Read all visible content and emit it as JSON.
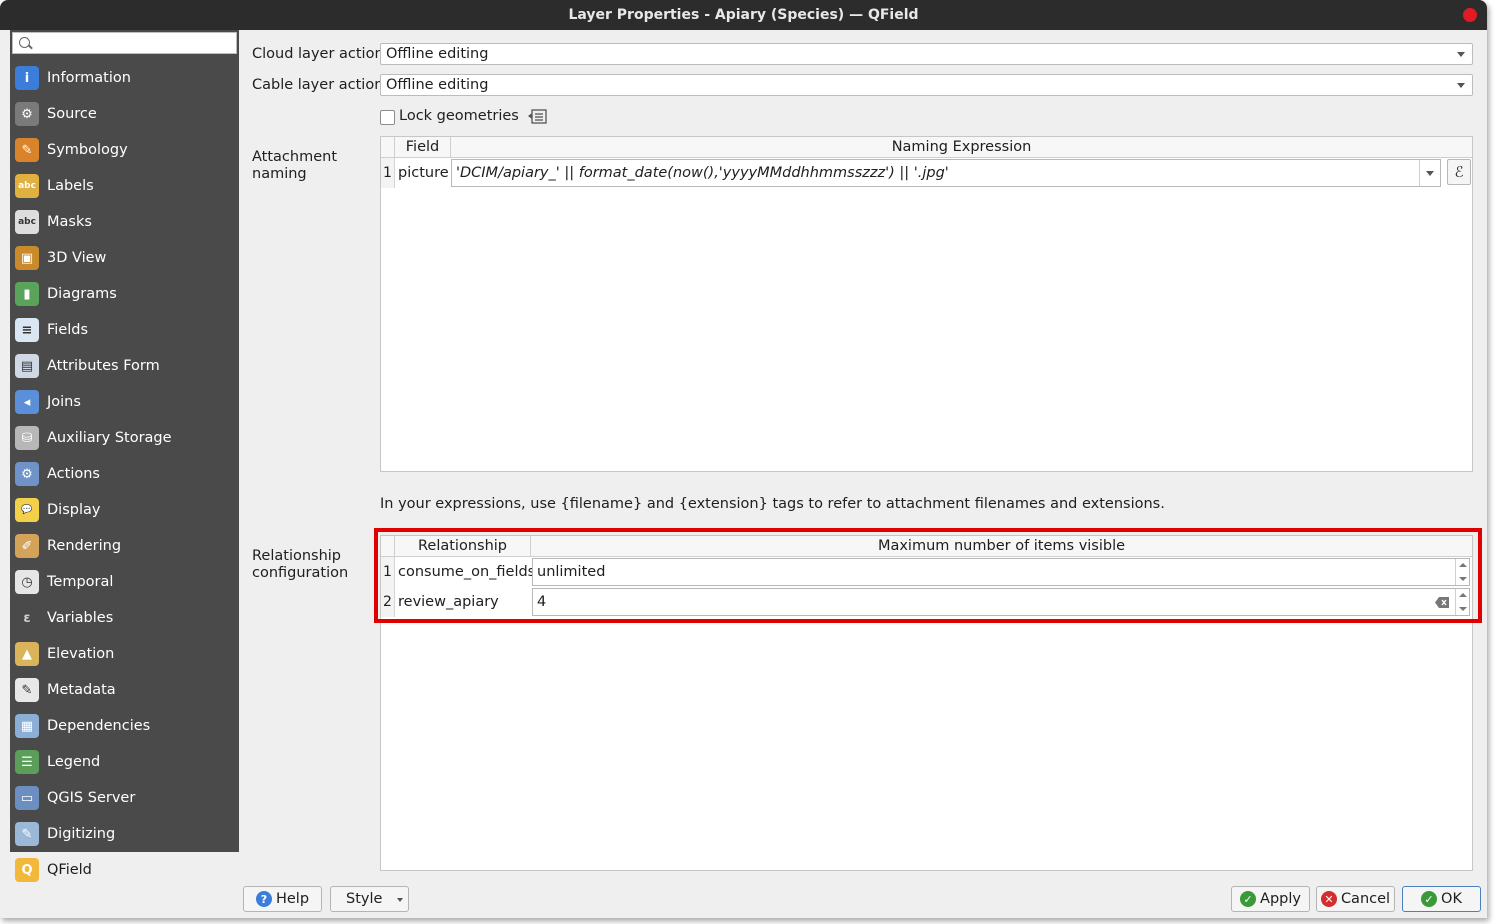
{
  "window": {
    "title": "Layer Properties - Apiary (Species) — QField"
  },
  "sidebar": {
    "search_placeholder": "",
    "items": [
      {
        "label": "Information",
        "icon": "information-icon",
        "color": "#3b7dd8",
        "glyph": "i"
      },
      {
        "label": "Source",
        "icon": "source-icon",
        "color": "#7a7a7a",
        "glyph": "⚙"
      },
      {
        "label": "Symbology",
        "icon": "symbology-icon",
        "color": "#d9842b",
        "glyph": "✎"
      },
      {
        "label": "Labels",
        "icon": "labels-icon",
        "color": "#e0b040",
        "glyph": "abc"
      },
      {
        "label": "Masks",
        "icon": "masks-icon",
        "color": "#dddddd",
        "glyph": "abc"
      },
      {
        "label": "3D View",
        "icon": "3d-view-icon",
        "color": "#c98a2b",
        "glyph": "▣"
      },
      {
        "label": "Diagrams",
        "icon": "diagrams-icon",
        "color": "#5aa35a",
        "glyph": "▮"
      },
      {
        "label": "Fields",
        "icon": "fields-icon",
        "color": "#dbe6f3",
        "glyph": "≡"
      },
      {
        "label": "Attributes Form",
        "icon": "attributes-form-icon",
        "color": "#cfd8e4",
        "glyph": "▤"
      },
      {
        "label": "Joins",
        "icon": "joins-icon",
        "color": "#5b8fd9",
        "glyph": "◂"
      },
      {
        "label": "Auxiliary Storage",
        "icon": "auxiliary-storage-icon",
        "color": "#b7b7b7",
        "glyph": "⛁"
      },
      {
        "label": "Actions",
        "icon": "actions-icon",
        "color": "#6f93c8",
        "glyph": "⚙"
      },
      {
        "label": "Display",
        "icon": "display-icon",
        "color": "#f2d04a",
        "glyph": "💬"
      },
      {
        "label": "Rendering",
        "icon": "rendering-icon",
        "color": "#d4a35a",
        "glyph": "✐"
      },
      {
        "label": "Temporal",
        "icon": "temporal-icon",
        "color": "#e6e6e6",
        "glyph": "◷"
      },
      {
        "label": "Variables",
        "icon": "variables-icon",
        "color": "#4a4a4a",
        "glyph": "ε"
      },
      {
        "label": "Elevation",
        "icon": "elevation-icon",
        "color": "#d9b45a",
        "glyph": "▲"
      },
      {
        "label": "Metadata",
        "icon": "metadata-icon",
        "color": "#e8e8e8",
        "glyph": "✎"
      },
      {
        "label": "Dependencies",
        "icon": "dependencies-icon",
        "color": "#8aaed6",
        "glyph": "▦"
      },
      {
        "label": "Legend",
        "icon": "legend-icon",
        "color": "#5a9e5a",
        "glyph": "☰"
      },
      {
        "label": "QGIS Server",
        "icon": "qgis-server-icon",
        "color": "#6c8fc2",
        "glyph": "▭"
      },
      {
        "label": "Digitizing",
        "icon": "digitizing-icon",
        "color": "#9bb8d9",
        "glyph": "✎"
      },
      {
        "label": "QField",
        "icon": "qfield-icon",
        "color": "#f1b83a",
        "glyph": "Q"
      }
    ]
  },
  "form": {
    "cloud_label": "Cloud layer action",
    "cloud_value": "Offline editing",
    "cable_label": "Cable layer action",
    "cable_value": "Offline editing",
    "lock_label": "Lock geometries",
    "attachment_label": "Attachment naming",
    "attachment_headers": {
      "field": "Field",
      "expr": "Naming Expression"
    },
    "attachment_rows": [
      {
        "num": "1",
        "field": "picture",
        "expr": "'DCIM/apiary_' || format_date(now(),'yyyyMMddhhmmsszzz') || '.jpg'"
      }
    ],
    "hint": "In your expressions, use {filename} and {extension} tags to refer to attachment filenames and extensions.",
    "relationship_label": "Relationship configuration",
    "relationship_headers": {
      "rel": "Relationship",
      "max": "Maximum number of items visible"
    },
    "relationship_rows": [
      {
        "num": "1",
        "name": "consume_on_fields",
        "value": "unlimited"
      },
      {
        "num": "2",
        "name": "review_apiary",
        "value": "4"
      }
    ]
  },
  "buttons": {
    "help": "Help",
    "style": "Style",
    "apply": "Apply",
    "cancel": "Cancel",
    "ok": "OK"
  }
}
